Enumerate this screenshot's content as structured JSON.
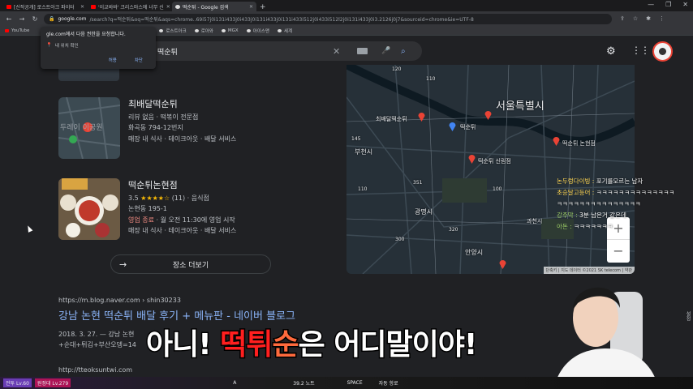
{
  "browser": {
    "tabs": [
      {
        "label": "[신작공개] 로스트아크 파이터",
        "icon": "youtube-icon"
      },
      {
        "label": "'이교바바' 크리스마스에 너무 신",
        "icon": "youtube-icon"
      },
      {
        "label": "떡순튀 - Google 검색",
        "icon": "google-icon",
        "active": true
      }
    ],
    "address": {
      "domain": "google.com",
      "path": "/search?q=떡순튀&oq=떡순튀&aqs=chrome..69i57j0i131i433j0i433j0i131i433j0i131i433i512j0i433i512l2j0i131i433j0i3.2126j0j7&sourceid=chrome&ie=UTF-8"
    },
    "bookmarks": [
      {
        "label": "YouTube",
        "icon": "youtube-icon"
      },
      {
        "label": "로스트아크",
        "icon": "bookmark-icon"
      },
      {
        "label": "로아와",
        "icon": "bookmark-icon"
      },
      {
        "label": "MGX",
        "icon": "bookmark-icon"
      },
      {
        "label": "아이스맨",
        "icon": "bookmark-icon"
      },
      {
        "label": "세계",
        "icon": "bookmark-icon"
      }
    ]
  },
  "permission_popup": {
    "title": "gle.com에서 다음 권한을 요청합니다.",
    "item": "내 위치 확인",
    "allow": "허용",
    "block": "차단"
  },
  "search": {
    "query": "떡순튀"
  },
  "places": [
    {
      "name": "최배달떡순튀",
      "line1": "리뷰 없음 · 떡볶이 전문점",
      "line2": "화곡동 794-12번지",
      "line3": "매장 내 식사 · 테이크아웃 · 배달 서비스",
      "thumb_text": "두레이 이공원"
    },
    {
      "name": "떡순튀논현점",
      "rating": "3.5",
      "stars": "★★★★☆",
      "reviews": "(11)",
      "category": "· 음식점",
      "line2": "논현동 195-1",
      "status_closed": "영업 종료",
      "status_rest": " · 월 오전 11:30에 영업 시작",
      "line3": "매장 내 식사 · 테이크아웃 · 배달 서비스"
    }
  ],
  "more_places": "장소 더보기",
  "map": {
    "cities": [
      "서울특별시",
      "부천시",
      "광명시",
      "안양시",
      "과천시"
    ],
    "pins": [
      "최배달떡순튀",
      "떡순튀",
      "떡순튀 논현점",
      "떡순튀 신림점"
    ],
    "footer": "단축키 | 지도 데이터 ©2021 SK telecom | 약관",
    "zoom_in": "+",
    "zoom_out": "−",
    "road_labels": [
      "120",
      "110",
      "100",
      "145",
      "351",
      "110",
      "300",
      "320"
    ]
  },
  "blog_result": {
    "url": "https://m.blog.naver.com › shin30233",
    "title": "강남 논현 떡순튀 배달 후기 + 메뉴판 - 네이버 블로그",
    "snippet1": "2018. 3. 27. — 강남 논현",
    "snippet2": "+순대+튀김+부산오뎅=14"
  },
  "next_result_url": "http://tteoksuntwi.com",
  "chat": [
    {
      "name": "논두렁다이빙 :",
      "text": "포기를모르는 남자"
    },
    {
      "name": "초승달고등어 :",
      "text": "ㅋㅋㅋㅋㅋㅋㅋㅋㅋㅋㅋㅋㅋㅋ"
    },
    {
      "name": "",
      "text": "ㅋㅋㅋㅋㅋㅋㅋㅋㅋㅋㅋㅋㅋㅋㅋ"
    },
    {
      "name": "강주막 :",
      "text": "3분 남은거 같은데"
    },
    {
      "name": "아돈 :",
      "text": "ㅋㅋㅋㅋㅋㅋㅋ"
    }
  ],
  "caption": {
    "part1": "아니! ",
    "red": "떡튀",
    "red2": "순",
    "part2": "은 어디말이야!"
  },
  "hud": {
    "badge1": "전투 Lv.60",
    "badge2": "원정대 Lv.279",
    "slot1": "A",
    "slot2": "39.2 노트",
    "slot3": "SPACE",
    "slot4": "자동 항로"
  },
  "side_label": "설정"
}
